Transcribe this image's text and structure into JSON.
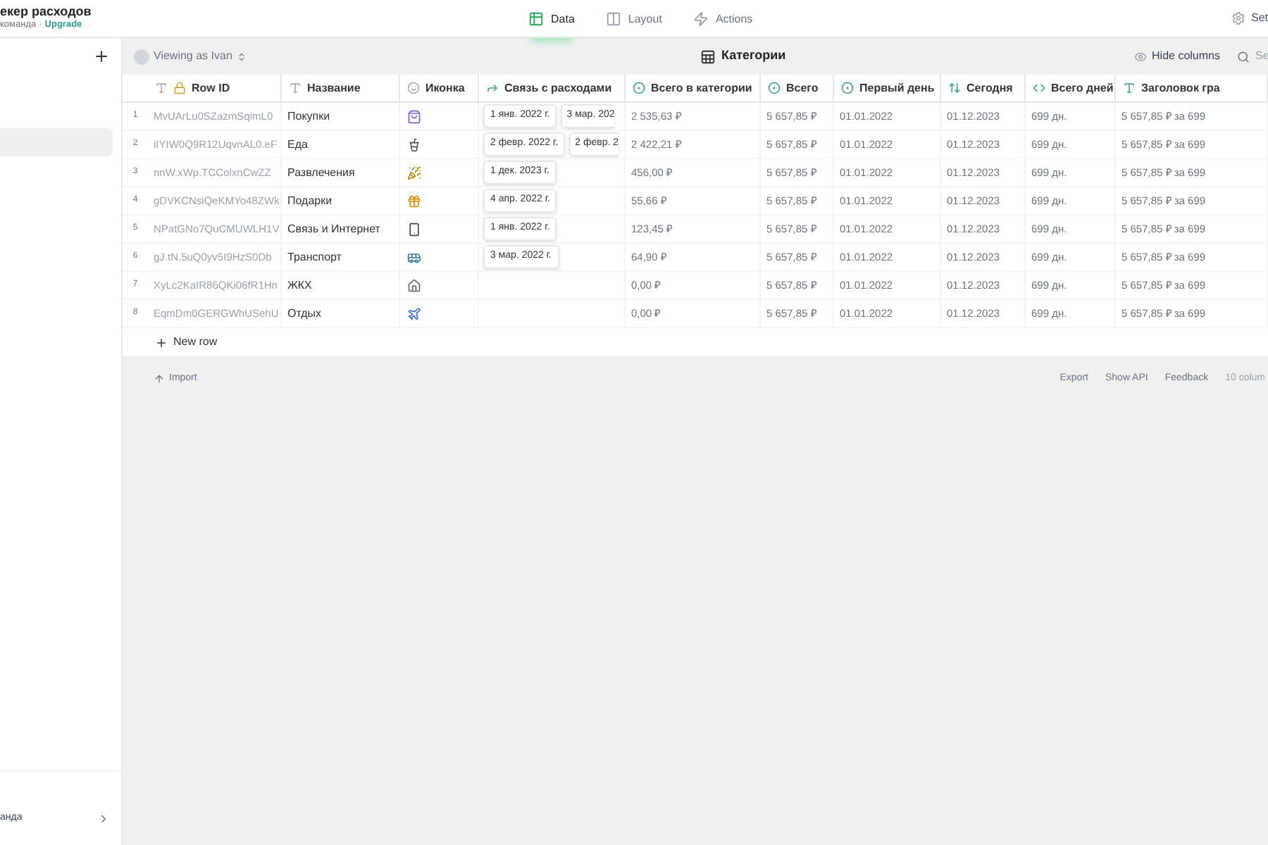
{
  "app": {
    "title": "екер расходов",
    "subtitle": "команда",
    "separator": "·",
    "upgrade": "Upgrade"
  },
  "tabs": [
    {
      "label": "Data",
      "selected": true
    },
    {
      "label": "Layout",
      "selected": false
    },
    {
      "label": "Actions",
      "selected": false
    }
  ],
  "settings": "Set",
  "sidebar": {
    "items": [
      {
        "selected": true
      }
    ],
    "footer": "анда"
  },
  "toolbar": {
    "viewing": "Viewing as Ivan",
    "table_title": "Категории",
    "hide_columns": "Hide columns",
    "search": "Se"
  },
  "columns": [
    {
      "label": "Row ID",
      "kind": "row_id"
    },
    {
      "label": "Название",
      "kind": "text"
    },
    {
      "label": "Иконка",
      "kind": "emoji"
    },
    {
      "label": "Связь с расходами",
      "kind": "relation"
    },
    {
      "label": "Всего в категории",
      "kind": "rollup"
    },
    {
      "label": "Всего",
      "kind": "rollup"
    },
    {
      "label": "Первый день",
      "kind": "rollup"
    },
    {
      "label": "Сегодня",
      "kind": "date"
    },
    {
      "label": "Всего дней",
      "kind": "code"
    },
    {
      "label": "Заголовок гра",
      "kind": "template"
    }
  ],
  "rows": [
    {
      "num": "1",
      "row_id": "MvUArLu0SZazmSqimL0",
      "name": "Покупки",
      "links": [
        "1 янв. 2022 г.",
        "3 мар. 202"
      ],
      "cells": [
        "2 535,63 ₽",
        "5 657,85 ₽",
        "01.01.2022",
        "01.12.2023",
        "699 дн.",
        "5 657,85 ₽ за 699"
      ]
    },
    {
      "num": "2",
      "row_id": "iIYIW0Q9R12UqvnAL0.eF",
      "name": "Еда",
      "links": [
        "2 февр. 2022 г.",
        "2 февр. 2"
      ],
      "cells": [
        "2 422,21 ₽",
        "5 657,85 ₽",
        "01.01.2022",
        "01.12.2023",
        "699 дн.",
        "5 657,85 ₽ за 699"
      ]
    },
    {
      "num": "3",
      "row_id": "nnW.xWp.TCColxnCwZZ",
      "name": "Развлечения",
      "links": [
        "1 дек. 2023 г."
      ],
      "cells": [
        "456,00 ₽",
        "5 657,85 ₽",
        "01.01.2022",
        "01.12.2023",
        "699 дн.",
        "5 657,85 ₽ за 699"
      ]
    },
    {
      "num": "4",
      "row_id": "gDVKCNsiQeKMYo48ZWk",
      "name": "Подарки",
      "links": [
        "4 апр. 2022 г."
      ],
      "cells": [
        "55,66 ₽",
        "5 657,85 ₽",
        "01.01.2022",
        "01.12.2023",
        "699 дн.",
        "5 657,85 ₽ за 699"
      ]
    },
    {
      "num": "5",
      "row_id": "NPatGNo7QuCMUWLH1V",
      "name": "Связь и Интернет",
      "links": [
        "1 янв. 2022 г."
      ],
      "cells": [
        "123,45 ₽",
        "5 657,85 ₽",
        "01.01.2022",
        "01.12.2023",
        "699 дн.",
        "5 657,85 ₽ за 699"
      ]
    },
    {
      "num": "6",
      "row_id": "gJ.tN.5uQ0yv5I9HzS0Db",
      "name": "Транспорт",
      "links": [
        "3 мар. 2022 г."
      ],
      "cells": [
        "64,90 ₽",
        "5 657,85 ₽",
        "01.01.2022",
        "01.12.2023",
        "699 дн.",
        "5 657,85 ₽ за 699"
      ]
    },
    {
      "num": "7",
      "row_id": "XyLc2KaIR86QKi06fR1Hn",
      "name": "ЖКХ",
      "links": [],
      "cells": [
        "0,00 ₽",
        "5 657,85 ₽",
        "01.01.2022",
        "01.12.2023",
        "699 дн.",
        "5 657,85 ₽ за 699"
      ]
    },
    {
      "num": "8",
      "row_id": "EqmDm0GERGWhUSehU",
      "name": "Отдых",
      "links": [],
      "cells": [
        "0,00 ₽",
        "5 657,85 ₽",
        "01.01.2022",
        "01.12.2023",
        "699 дн.",
        "5 657,85 ₽ за 699"
      ]
    }
  ],
  "new_row": "New row",
  "footer": {
    "import": "Import",
    "actions": [
      "Export",
      "Show API",
      "Feedback",
      "10 colum"
    ]
  }
}
